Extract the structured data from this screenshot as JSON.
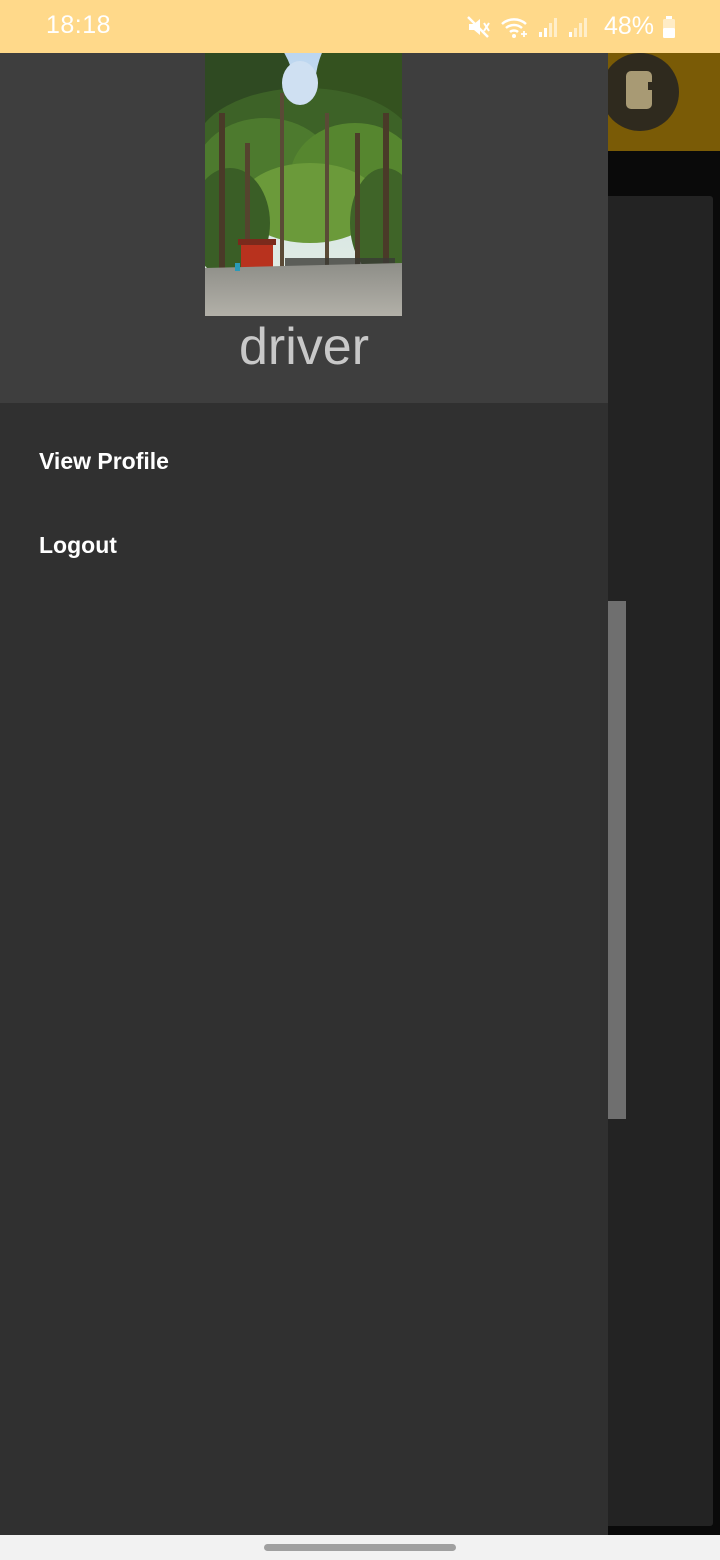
{
  "status_bar": {
    "time": "18:18",
    "battery": "48%",
    "icons": [
      "mute-icon",
      "wifi-icon",
      "signal-icon",
      "signal-icon",
      "battery-icon"
    ]
  },
  "drawer": {
    "username": "driver",
    "photo_icon": "profile-photo-forest",
    "menu": [
      {
        "label": "View Profile"
      },
      {
        "label": "Logout"
      }
    ]
  },
  "colors": {
    "status_bar_bg": "#ffd98a",
    "drawer_bg": "#303030",
    "drawer_header_bg": "#3e3e3e",
    "app_header_bg": "#7a5b06"
  }
}
